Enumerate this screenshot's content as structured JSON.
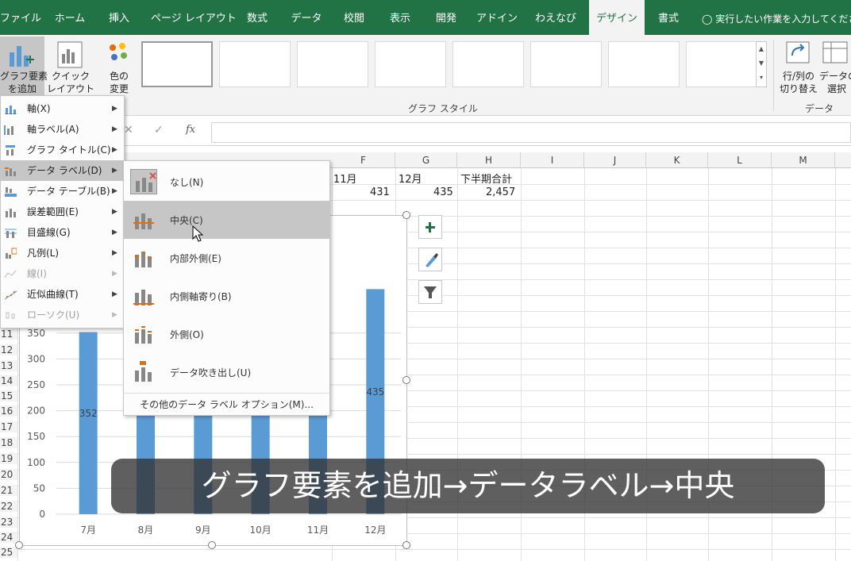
{
  "tabs": [
    "ファイル",
    "ホーム",
    "挿入",
    "ページ レイアウト",
    "数式",
    "データ",
    "校閲",
    "表示",
    "開発",
    "アドイン",
    "わえなび",
    "デザイン",
    "書式"
  ],
  "tell_me": "実行したい作業を入力してくださ",
  "ribbon": {
    "add_element": [
      "グラフ要素",
      "を追加"
    ],
    "quick_layout": [
      "クイック",
      "レイアウト"
    ],
    "change_color": [
      "色の",
      "変更"
    ],
    "chart_styles_label": "グラフ スタイル",
    "switch_row_col": [
      "行/列の",
      "切り替え"
    ],
    "select_data": [
      "データの",
      "選択"
    ],
    "data_group_label": "データ"
  },
  "formula_bar": {
    "fx": "fx"
  },
  "columns": [
    "F",
    "G",
    "H",
    "I",
    "J",
    "K",
    "L",
    "M"
  ],
  "rows": [
    "11",
    "12",
    "13",
    "14",
    "15",
    "16",
    "17",
    "18",
    "19",
    "20",
    "21",
    "22",
    "23",
    "24",
    "25"
  ],
  "cells": {
    "f_hdr": "11月",
    "g_hdr": "12月",
    "h_hdr": "下半期合計",
    "f_val": "431",
    "g_val": "435",
    "h_val": "2,457"
  },
  "chart_data": {
    "type": "bar",
    "categories": [
      "7月",
      "8月",
      "9月",
      "10月",
      "11月",
      "12月"
    ],
    "visible_values": {
      "7月": 352,
      "12月": 435
    },
    "y_ticks": [
      0,
      50,
      100,
      150,
      200,
      250,
      300,
      350
    ],
    "data_labels": [
      "352",
      "435"
    ],
    "bar_color": "#5b9bd5"
  },
  "menu": {
    "items": [
      {
        "label": "軸(X)",
        "icon": "axis-icon",
        "enabled": true
      },
      {
        "label": "軸ラベル(A)",
        "icon": "axis-label-icon",
        "enabled": true
      },
      {
        "label": "グラフ タイトル(C)",
        "icon": "chart-title-icon",
        "enabled": true
      },
      {
        "label": "データ ラベル(D)",
        "icon": "data-label-icon",
        "enabled": true
      },
      {
        "label": "データ テーブル(B)",
        "icon": "data-table-icon",
        "enabled": true
      },
      {
        "label": "誤差範囲(E)",
        "icon": "error-bars-icon",
        "enabled": true
      },
      {
        "label": "目盛線(G)",
        "icon": "gridlines-icon",
        "enabled": true
      },
      {
        "label": "凡例(L)",
        "icon": "legend-icon",
        "enabled": true
      },
      {
        "label": "線(I)",
        "icon": "lines-icon",
        "enabled": false
      },
      {
        "label": "近似曲線(T)",
        "icon": "trendline-icon",
        "enabled": true
      },
      {
        "label": "ローソク(U)",
        "icon": "updown-bars-icon",
        "enabled": false
      }
    ]
  },
  "submenu": {
    "items": [
      "なし(N)",
      "中央(C)",
      "内部外側(E)",
      "内側軸寄り(B)",
      "外側(O)",
      "データ吹き出し(U)"
    ],
    "more": "その他のデータ ラベル オプション(M)..."
  },
  "caption": "グラフ要素を追加→データラベル→中央"
}
